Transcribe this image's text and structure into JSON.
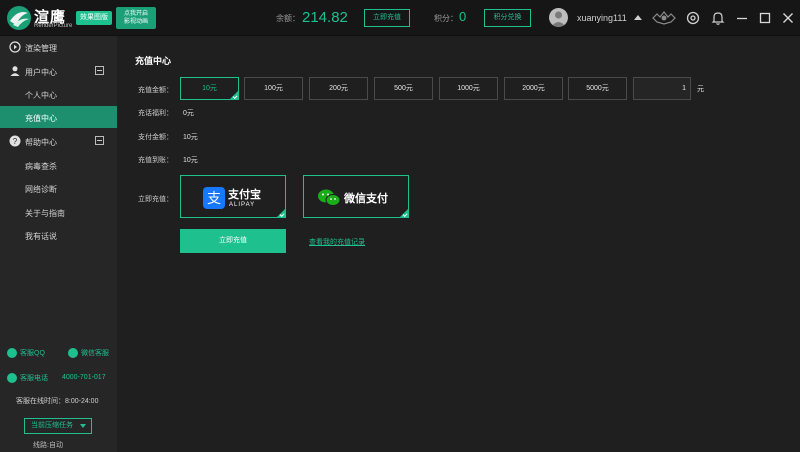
{
  "app": {
    "logo_title": "渲鹰",
    "logo_subtitle": "RenderPicture",
    "edition_badge": "效果图版",
    "promo_line1": "点我开启",
    "promo_line2": "影视动画"
  },
  "header": {
    "balance_label": "余额：",
    "balance_value": "214.82",
    "recharge_button": "立即充值",
    "points_label": "积分：",
    "points_value": "0",
    "redeem_button": "积分兑换",
    "username": "xuanying111",
    "icons": [
      "vip-badge-icon",
      "settings-icon",
      "bell-icon",
      "minimize-icon",
      "maximize-icon",
      "close-icon"
    ]
  },
  "sidebar": {
    "render_manage": "渲染管理",
    "user_center": "用户中心",
    "personal_center": "个人中心",
    "recharge_center": "充值中心",
    "help_center": "帮助中心",
    "virus_scan": "病毒查杀",
    "network_diag": "网络诊断",
    "about_guide": "关于与指南",
    "feedback": "我有话说",
    "cs_qq": "客服QQ",
    "cs_wechat": "微信客服",
    "cs_phone_label": "客服电话",
    "cs_phone": "4000-701-017",
    "cs_hours": "客服在线时间：8:00-24:00",
    "task_dropdown": "当前压缩任务",
    "route": "线路:自动"
  },
  "main": {
    "title": "充值中心",
    "amount_label": "充值金额：",
    "amounts": [
      "10元",
      "100元",
      "200元",
      "500元",
      "1000元",
      "2000元",
      "5000元"
    ],
    "selected_amount_index": 0,
    "custom_amount_value": "1",
    "unit": "元",
    "bonus_label": "充话福利：",
    "bonus_value": "0元",
    "pay_amount_label": "支付金额：",
    "pay_amount_value": "10元",
    "arrive_label": "充值到账：",
    "arrive_value": "10元",
    "pay_method_label": "立即充值：",
    "alipay_text": "支付宝",
    "alipay_sub": "ALIPAY",
    "wechat_text": "微信支付",
    "submit_button": "立即充值",
    "history_link": "查看我的充值记录"
  },
  "colors": {
    "accent": "#1ec08e",
    "sidebar_active": "#1d8f6f",
    "alipay_blue": "#1678ff",
    "wechat_green": "#1aad19"
  }
}
